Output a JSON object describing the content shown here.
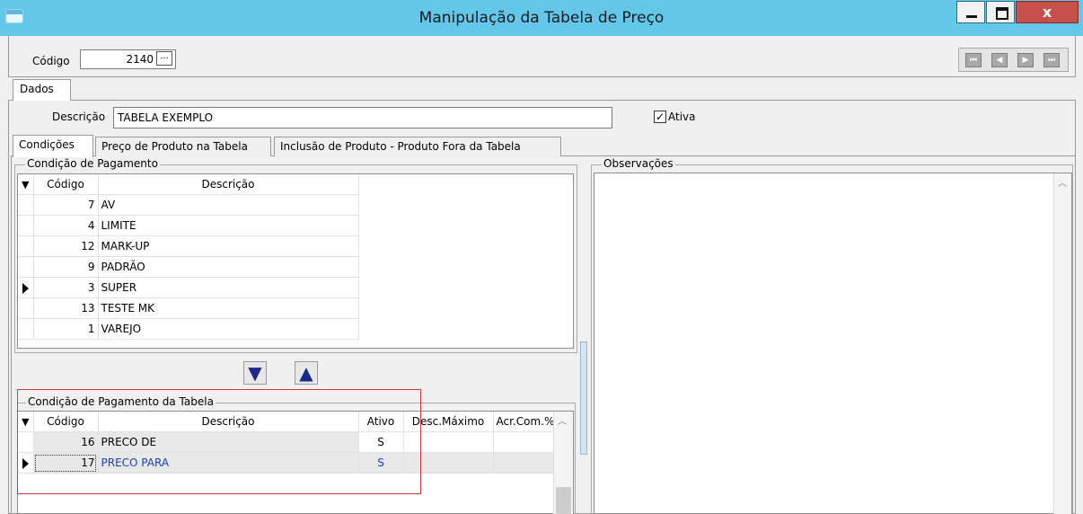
{
  "window": {
    "title": "Manipulação da Tabela de Preço",
    "close_label": "x"
  },
  "header": {
    "codigo_label": "Código",
    "codigo_value": "2140",
    "lookup_label": "...",
    "nav_buttons": [
      "⏮",
      "◀",
      "▶",
      "⏭"
    ]
  },
  "tabs": {
    "dados": "Dados"
  },
  "dados": {
    "descricao_label": "Descrição",
    "descricao_value": "TABELA EXEMPLO",
    "ativo_label": "Ativa",
    "ativo_checked": true
  },
  "inner_tabs": [
    "Condições",
    "Preço de Produto na Tabela",
    "Inclusão de Produto - Produto Fora da Tabela"
  ],
  "condicao_pagamento": {
    "legend": "Condição de Pagamento",
    "columns": [
      "Código",
      "Descrição"
    ],
    "rows": [
      {
        "codigo": "7",
        "descricao": "AV",
        "current": false
      },
      {
        "codigo": "4",
        "descricao": "LIMITE",
        "current": false
      },
      {
        "codigo": "12",
        "descricao": "MARK-UP",
        "current": false
      },
      {
        "codigo": "9",
        "descricao": "PADRÃO",
        "current": false
      },
      {
        "codigo": "3",
        "descricao": "SUPER",
        "current": true
      },
      {
        "codigo": "13",
        "descricao": "TESTE MK",
        "current": false
      },
      {
        "codigo": "1",
        "descricao": "VAREJO",
        "current": false
      }
    ]
  },
  "move_buttons": {
    "down": "▼",
    "up": "▲"
  },
  "condicao_tabela": {
    "legend": "Condição de Pagamento da Tabela",
    "columns": [
      "Código",
      "Descrição",
      "Ativo",
      "Desc.Máximo",
      "Acr.Com.%"
    ],
    "rows": [
      {
        "codigo": "16",
        "descricao": "PRECO DE",
        "ativo": "S",
        "desc_max": "",
        "acr_com": "",
        "current": false
      },
      {
        "codigo": "17",
        "descricao": "PRECO PARA",
        "ativo": "S",
        "desc_max": "",
        "acr_com": "",
        "current": true
      }
    ]
  },
  "observacoes": {
    "legend": "Observações"
  },
  "colors": {
    "titlebar": "#63c7ea",
    "close": "#c7504a",
    "highlight": "#1a3fbf",
    "red_box": "#d63b3b"
  }
}
